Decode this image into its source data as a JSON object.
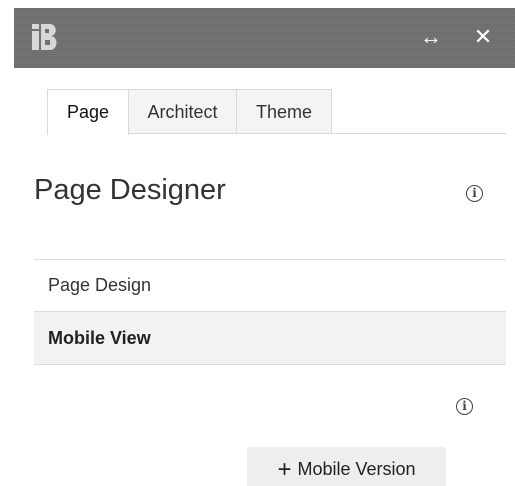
{
  "titlebar": {
    "logo_icon": "builder-logo-icon",
    "resize_icon": "↔",
    "close_icon": "✕"
  },
  "tabs": [
    {
      "label": "Page",
      "active": true
    },
    {
      "label": "Architect",
      "active": false
    },
    {
      "label": "Theme",
      "active": false
    }
  ],
  "heading": {
    "title": "Page Designer",
    "info_icon": "i"
  },
  "list": {
    "items": [
      {
        "label": "Page Design",
        "selected": false
      },
      {
        "label": "Mobile View",
        "selected": true
      }
    ]
  },
  "mobile": {
    "info_icon": "i",
    "add_button_plus": "+",
    "add_button_label": "Mobile Version"
  },
  "colors": {
    "titlebar": "#6f6f6f",
    "selected_row": "#f2f2f2",
    "button_bg": "#eeeeee"
  }
}
